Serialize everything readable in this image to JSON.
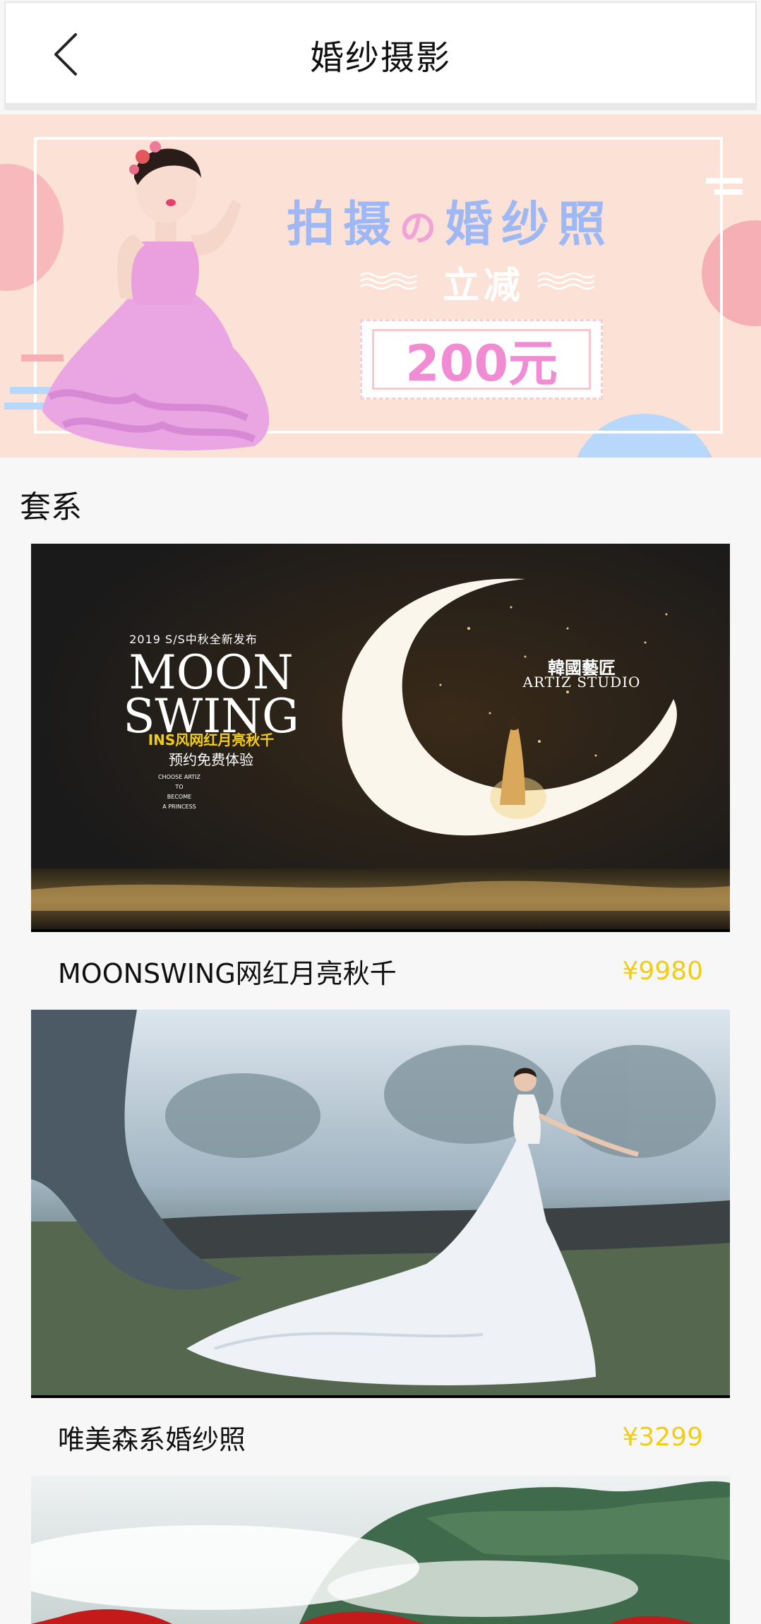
{
  "header": {
    "title": "婚纱摄影"
  },
  "banner": {
    "slogan_a": "拍摄",
    "slogan_de": "の",
    "slogan_b": "婚纱照",
    "reduce_label": "立减",
    "amount": "200元",
    "colors": {
      "background": "#fbe1d6",
      "slogan": "#9db8f4",
      "amount": "#f18bd4"
    }
  },
  "section": {
    "title": "套系"
  },
  "packages": [
    {
      "poster": {
        "year_line": "2019 S/S中秋全新发布",
        "headline_1": "MOON",
        "headline_2": "SWING",
        "sub_1": "INS风网红月亮秋千",
        "sub_2": "预约免费体验",
        "tagline": [
          "CHOOSE ARTIZ",
          "TO",
          "BECOME",
          "A PRINCESS"
        ],
        "studio_cn": "韓國藝匠",
        "studio_en": "ARTIZ STUDIO"
      },
      "name": "MOONSWING网红月亮秋千",
      "price": "¥9980"
    },
    {
      "name": "唯美森系婚纱照",
      "price": "¥3299"
    },
    {
      "name": "",
      "price": ""
    }
  ],
  "colors": {
    "price": "#f3cd12",
    "page_background": "#f7f7f7"
  },
  "icons": {
    "back": "chevron-left-icon"
  }
}
